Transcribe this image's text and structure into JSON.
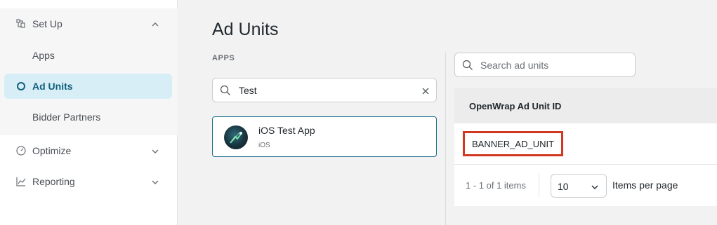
{
  "sidebar": {
    "setup": {
      "label": "Set Up",
      "icon": "setup-icon",
      "expanded": true
    },
    "items": [
      {
        "label": "Apps"
      },
      {
        "label": "Ad Units",
        "active": true,
        "icon": "circle-icon"
      },
      {
        "label": "Bidder Partners"
      }
    ],
    "optimize": {
      "label": "Optimize",
      "icon": "gauge-icon"
    },
    "reporting": {
      "label": "Reporting",
      "icon": "chart-line-icon"
    }
  },
  "page": {
    "title": "Ad Units"
  },
  "apps_panel": {
    "heading": "APPS",
    "search_value": "Test",
    "apps": [
      {
        "name": "iOS Test App",
        "platform": "iOS"
      }
    ]
  },
  "units_panel": {
    "search_placeholder": "Search ad units",
    "table": {
      "columns": [
        "OpenWrap Ad Unit ID"
      ],
      "rows": [
        [
          "BANNER_AD_UNIT"
        ]
      ]
    },
    "pagination": {
      "range": "1 - 1 of 1 items",
      "page_size": "10",
      "page_size_label": "Items per page"
    }
  },
  "colors": {
    "active_bg": "#d8eef6",
    "active_text": "#0f5f7d",
    "highlight_border": "#d2371f",
    "card_border": "#1d6e8c"
  }
}
